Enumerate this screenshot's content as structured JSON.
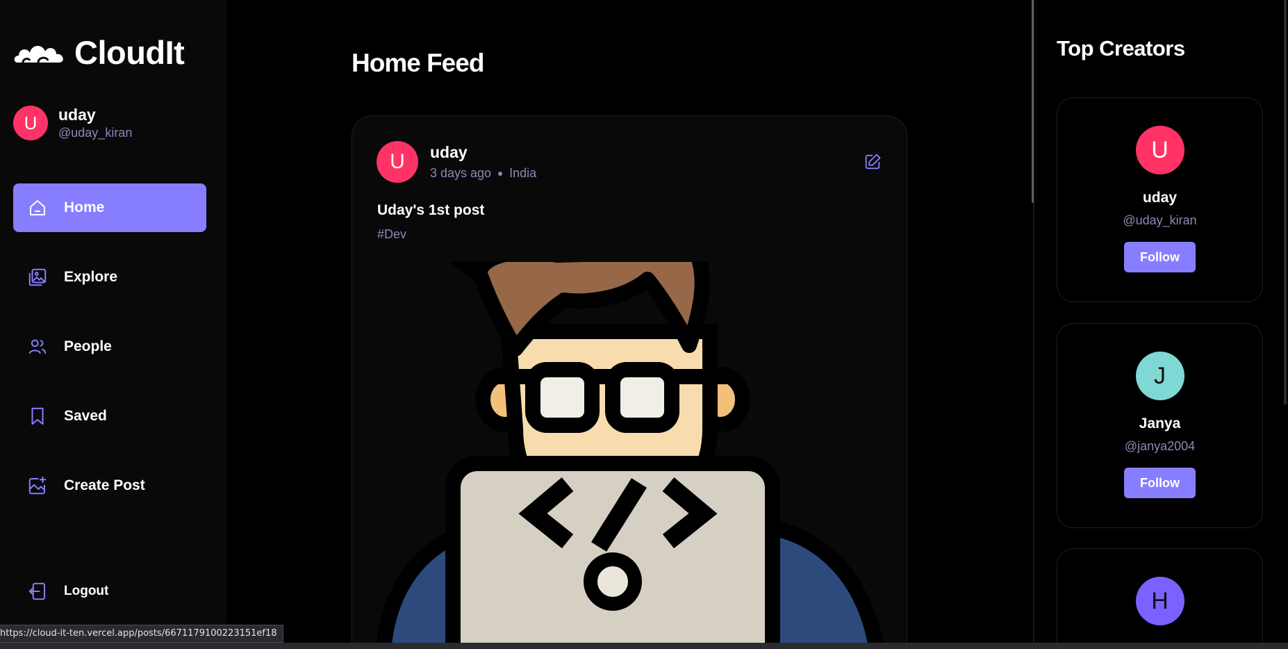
{
  "app": {
    "name": "CloudIt"
  },
  "current_user": {
    "initial": "U",
    "name": "uday",
    "handle": "@uday_kiran",
    "avatar_color": "#ff3366"
  },
  "nav": {
    "items": [
      {
        "label": "Home",
        "icon": "home-icon",
        "active": true
      },
      {
        "label": "Explore",
        "icon": "gallery-icon",
        "active": false
      },
      {
        "label": "People",
        "icon": "people-icon",
        "active": false
      },
      {
        "label": "Saved",
        "icon": "bookmark-icon",
        "active": false
      },
      {
        "label": "Create Post",
        "icon": "add-image-icon",
        "active": false
      }
    ],
    "logout_label": "Logout"
  },
  "feed": {
    "title": "Home Feed",
    "posts": [
      {
        "author_initial": "U",
        "author": "uday",
        "author_color": "#ff3366",
        "time": "3 days ago",
        "location": "India",
        "caption": "Uday's 1st post",
        "tags": "#Dev",
        "image": "developer-illustration"
      }
    ]
  },
  "top_creators": {
    "title": "Top Creators",
    "follow_label": "Follow",
    "creators": [
      {
        "initial": "U",
        "name": "uday",
        "handle": "@uday_kiran",
        "color": "#ff3366"
      },
      {
        "initial": "J",
        "name": "Janya",
        "handle": "@janya2004",
        "color": "#7fd8d3"
      },
      {
        "initial": "H",
        "color": "#7b61ff"
      }
    ]
  },
  "status_bar": {
    "url": "https://cloud-it-ten.vercel.app/posts/6671179100223151ef18"
  },
  "colors": {
    "accent": "#877eff",
    "muted_text": "#8d88b8",
    "sidebar_bg": "#09090a"
  }
}
